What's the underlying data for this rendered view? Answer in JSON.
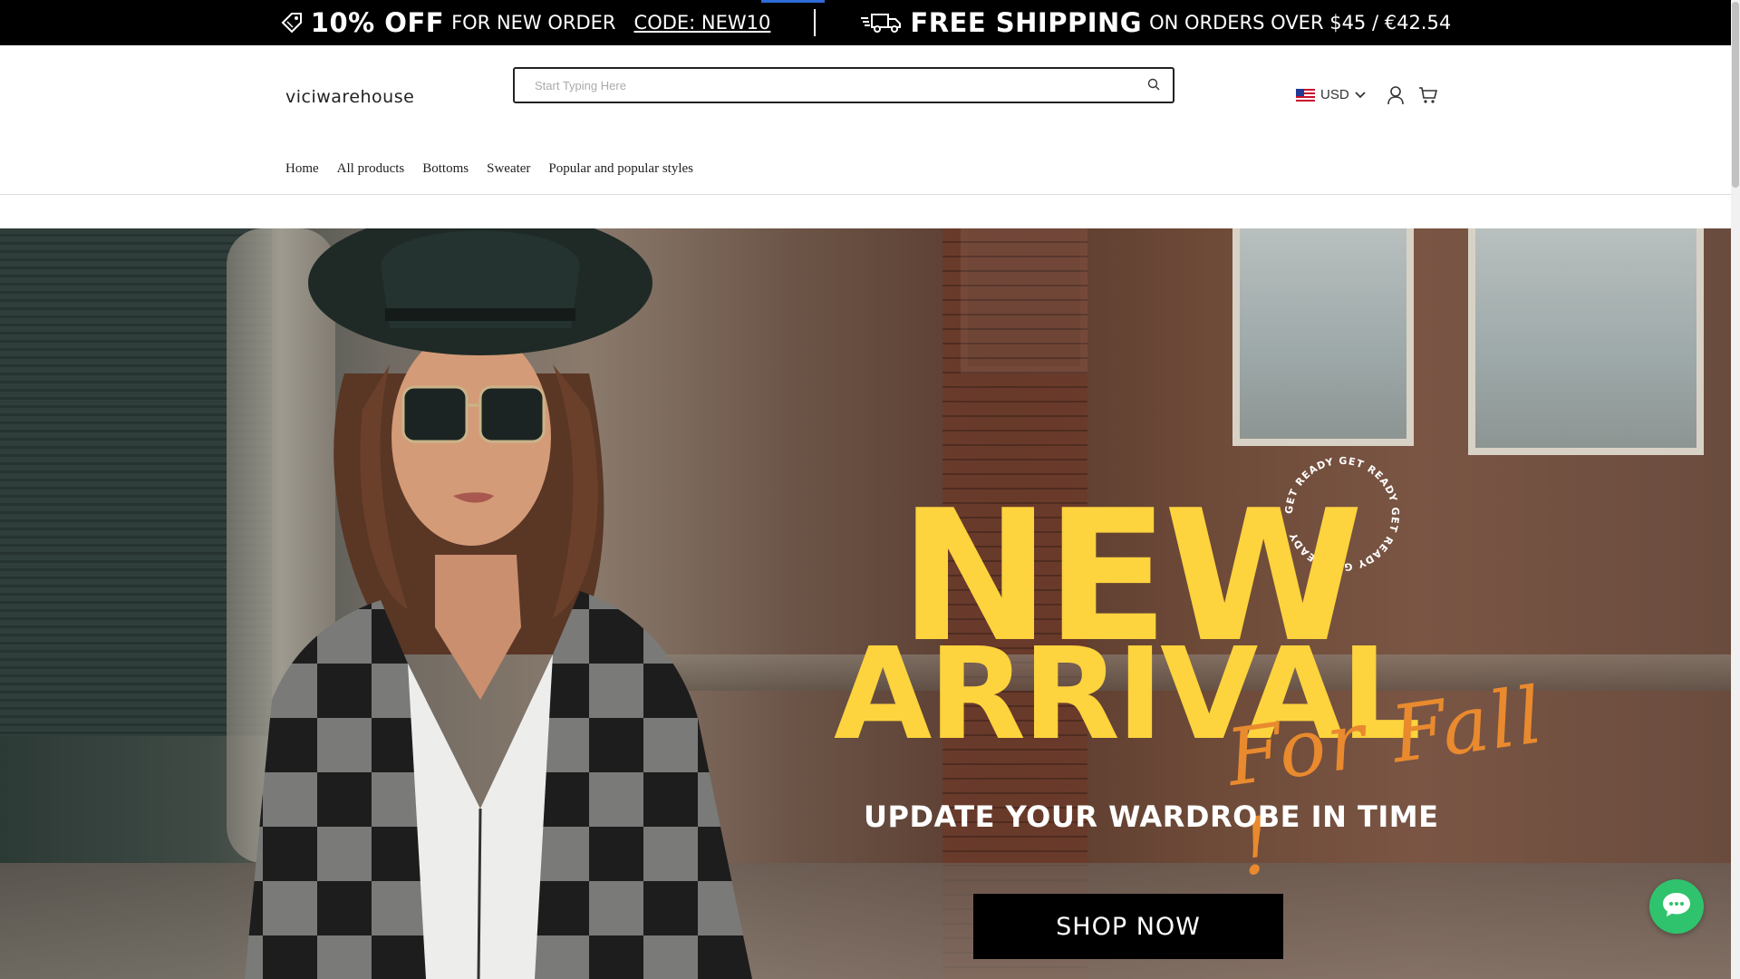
{
  "announcement": {
    "offer_strong": "10% OFF",
    "offer_text": "FOR NEW ORDER",
    "offer_code": "CODE: NEW10",
    "shipping_strong": "FREE SHIPPING",
    "shipping_text": "ON ORDERS OVER $45 / €42.54",
    "icons": [
      "tag-icon",
      "truck-icon"
    ]
  },
  "header": {
    "logo": "viciwarehouse",
    "search": {
      "placeholder": "Start Typing Here",
      "value": ""
    },
    "currency": {
      "label": "USD",
      "flag": "us-flag-icon"
    },
    "icons": [
      "search-icon",
      "chevron-down-icon",
      "user-icon",
      "cart-icon"
    ]
  },
  "nav": {
    "items": [
      {
        "label": "Home"
      },
      {
        "label": "All products"
      },
      {
        "label": "Bottoms"
      },
      {
        "label": "Sweater"
      },
      {
        "label": "Popular and popular styles"
      }
    ]
  },
  "hero": {
    "headline_1": "NEW",
    "headline_2": "ARRIVAL",
    "script": "For Fall !",
    "subheadline": "UPDATE YOUR WARDROBE IN TIME",
    "badge_text": "GET READY GET READY GET READY GET READY",
    "cta": "SHOP NOW"
  },
  "chat": {
    "icon": "chat-bubble-icon"
  },
  "colors": {
    "announcement_bg": "#000000",
    "headline_yellow": "#fdd33e",
    "script_orange": "#e98a2e",
    "chat_green": "#30c36d"
  }
}
